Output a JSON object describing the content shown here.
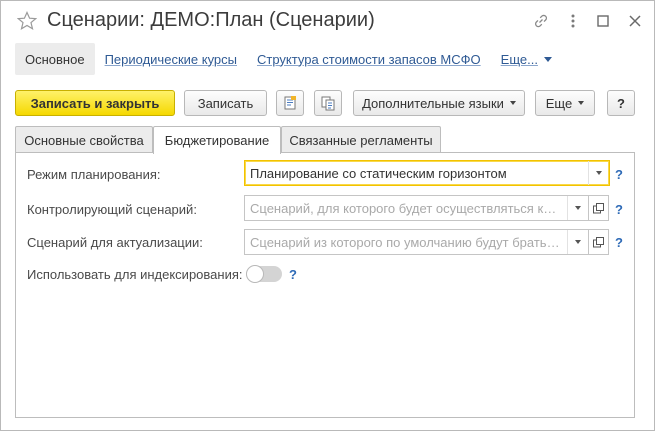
{
  "window": {
    "title": "Сценарии: ДЕМО:План (Сценарии)",
    "icons": [
      "star-icon",
      "link-icon",
      "more-icon",
      "maximize-icon",
      "close-icon"
    ]
  },
  "nav": {
    "items": [
      "Основное",
      "Периодические курсы",
      "Структура стоимости запасов МСФО",
      "Еще..."
    ],
    "active": "Основное"
  },
  "toolbar": {
    "save_close": "Записать и закрыть",
    "save": "Записать",
    "extra_languages": "Дополнительные языки",
    "more": "Еще",
    "help": "?"
  },
  "tabs": {
    "items": [
      "Основные свойства",
      "Бюджетирование",
      "Связанные регламенты"
    ],
    "active": "Бюджетирование"
  },
  "form": {
    "planning_mode": {
      "label": "Режим планирования:",
      "value": "Планирование со статическим горизонтом"
    },
    "controlling_scenario": {
      "label": "Контролирующий сценарий:",
      "placeholder": "Сценарий, для которого будет осуществляться кон..."
    },
    "actualization_scenario": {
      "label": "Сценарий для актуализации:",
      "placeholder": "Сценарий из которого по умолчанию будут братьс..."
    },
    "use_for_indexing": {
      "label": "Использовать для индексирования:",
      "value": false
    },
    "help": "?"
  },
  "colors": {
    "primary_button": "#f5d800",
    "link": "#2f5a94",
    "help": "#2f6bb7",
    "focus_border": "#f2c200"
  }
}
